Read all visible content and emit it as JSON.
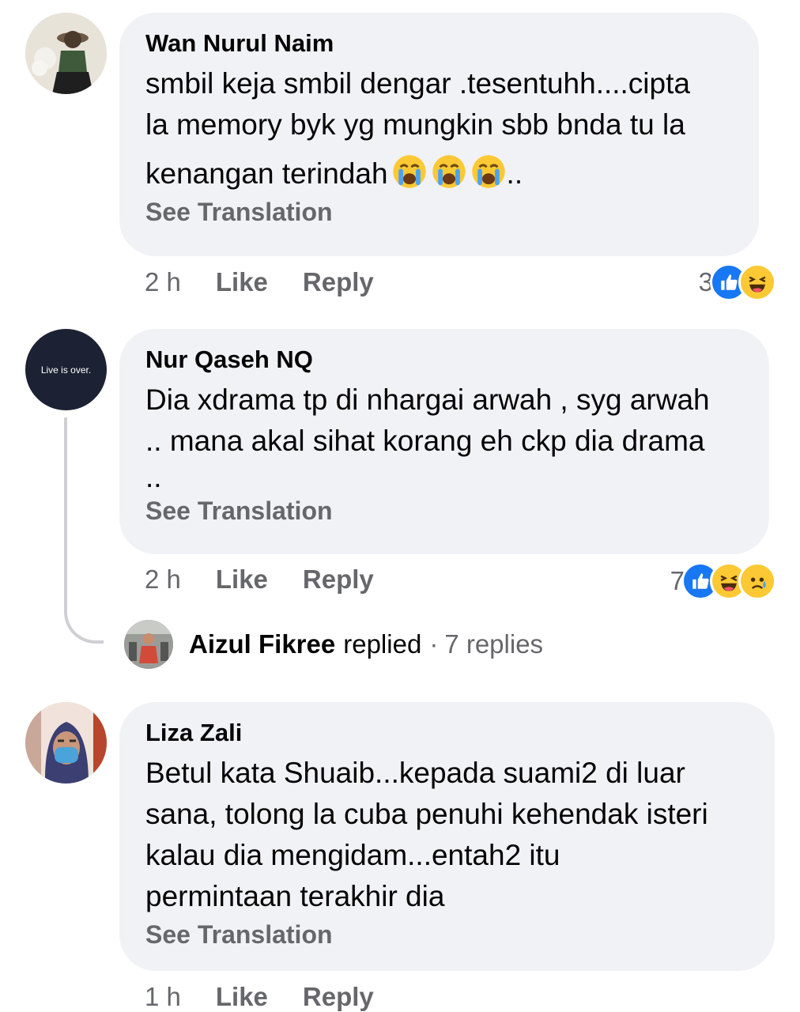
{
  "comments": [
    {
      "author": "Wan Nurul Naim",
      "text_lines": [
        "smbil keja smbil dengar .tesentuhh....cipta",
        "la memory byk yg mungkin sbb bnda tu la",
        "kenangan terindah"
      ],
      "text_tail": "..",
      "see_translation": "See Translation",
      "time": "2 h",
      "like": "Like",
      "reply": "Reply",
      "reaction_count": "3",
      "reactions": [
        "like-reaction",
        "haha-reaction"
      ]
    },
    {
      "author": "Nur Qaseh NQ",
      "avatar_text": "Live is over.",
      "text_lines": [
        "Dia xdrama tp di nhargai arwah , syg arwah",
        ".. mana akal sihat korang eh ckp dia drama",
        ".."
      ],
      "see_translation": "See Translation",
      "time": "2 h",
      "like": "Like",
      "reply": "Reply",
      "reaction_count": "7",
      "reactions": [
        "like-reaction",
        "haha-reaction",
        "sad-reaction"
      ],
      "replies_summary": {
        "author": "Aizul Fikree",
        "verb": "replied",
        "separator": "·",
        "count_text": "7 replies"
      }
    },
    {
      "author": "Liza Zali",
      "text_lines": [
        "Betul kata Shuaib...kepada suami2 di luar",
        "sana, tolong la cuba penuhi kehendak isteri",
        "kalau dia mengidam...entah2 itu",
        "permintaan terakhir dia"
      ],
      "see_translation": "See Translation",
      "time": "1 h",
      "like": "Like",
      "reply": "Reply"
    }
  ],
  "colors": {
    "bubble": "#f0f2f5",
    "secondary_text": "#65676b",
    "like_blue": "#1877f2",
    "emoji_yellow": "#fcc934"
  }
}
